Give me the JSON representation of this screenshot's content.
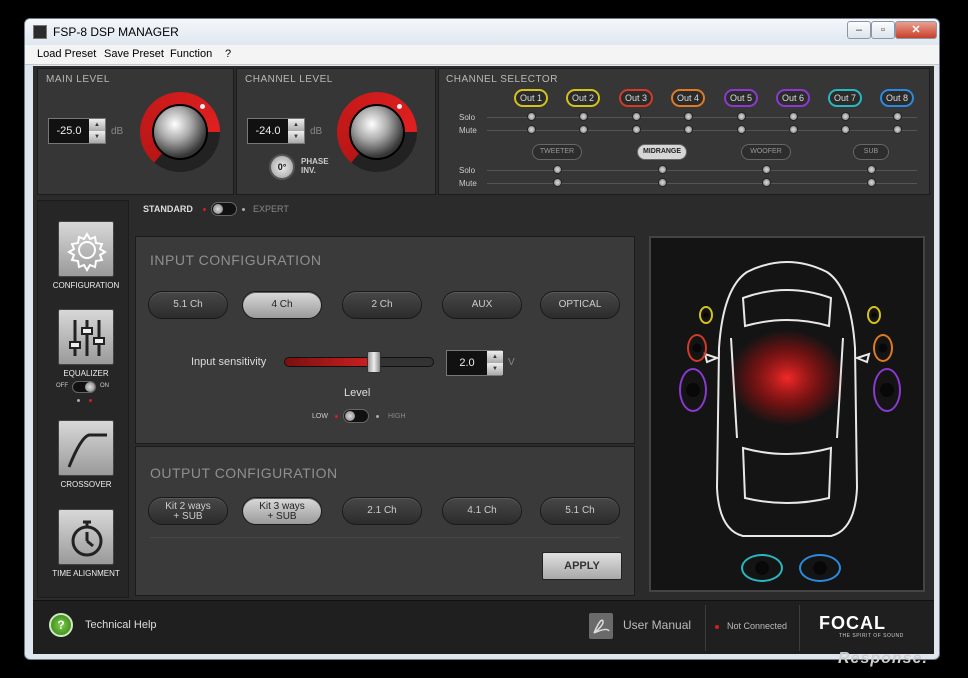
{
  "window": {
    "title": "FSP-8 DSP MANAGER",
    "min_glyph": "‒",
    "max_glyph": "▫",
    "close_glyph": "✕"
  },
  "menu": [
    "Load Preset",
    "Save Preset",
    "Function",
    "?"
  ],
  "main_level": {
    "label": "MAIN LEVEL",
    "value": "-25.0",
    "unit": "dB"
  },
  "channel_level": {
    "label": "CHANNEL LEVEL",
    "value": "-24.0",
    "unit": "dB",
    "phase_symbol": "0°",
    "phase_label_1": "PHASE",
    "phase_label_2": "INV."
  },
  "channel_selector": {
    "label": "CHANNEL SELECTOR",
    "outputs": [
      {
        "label": "Out 1",
        "color": "#d4c21a"
      },
      {
        "label": "Out 2",
        "color": "#d4c21a"
      },
      {
        "label": "Out 3",
        "color": "#d23a2a"
      },
      {
        "label": "Out 4",
        "color": "#e07a20"
      },
      {
        "label": "Out 5",
        "color": "#8a3ad0"
      },
      {
        "label": "Out 6",
        "color": "#8a3ad0"
      },
      {
        "label": "Out 7",
        "color": "#28b8c0"
      },
      {
        "label": "Out 8",
        "color": "#2a8ae0"
      }
    ],
    "solo_label": "Solo",
    "mute_label": "Mute",
    "groups": [
      "TWEETER",
      "MIDRANGE",
      "WOOFER",
      "SUB"
    ],
    "active_group": "MIDRANGE"
  },
  "mode": {
    "left": "STANDARD",
    "right": "EXPERT"
  },
  "sidebar": [
    {
      "label": "CONFIGURATION",
      "icon": "gear-icon"
    },
    {
      "label": "EQUALIZER",
      "icon": "sliders-icon"
    },
    {
      "label": "CROSSOVER",
      "icon": "crossover-curve-icon"
    },
    {
      "label": "TIME ALIGNMENT",
      "icon": "stopwatch-icon"
    }
  ],
  "eq_toggle": {
    "off": "OFF",
    "on": "ON"
  },
  "input_config": {
    "title": "INPUT CONFIGURATION",
    "buttons": [
      "5.1 Ch",
      "4 Ch",
      "2 Ch",
      "AUX",
      "OPTICAL"
    ],
    "selected": "4 Ch",
    "sensitivity_label": "Input sensitivity",
    "sensitivity_value": "2.0",
    "sensitivity_unit": "V",
    "sensitivity_fraction": 0.6,
    "level_label": "Level",
    "level_low": "LOW",
    "level_high": "HIGH"
  },
  "output_config": {
    "title": "OUTPUT CONFIGURATION",
    "buttons": [
      {
        "line1": "Kit 2 ways",
        "line2": "+ SUB"
      },
      {
        "line1": "Kit 3 ways",
        "line2": "+ SUB"
      },
      {
        "line1": "2.1 Ch",
        "line2": ""
      },
      {
        "line1": "4.1 Ch",
        "line2": ""
      },
      {
        "line1": "5.1 Ch",
        "line2": ""
      }
    ],
    "selected_index": 1,
    "apply_label": "APPLY"
  },
  "footer": {
    "help_symbol": "?",
    "help_label": "Technical Help",
    "manual_label": "User Manual",
    "status": "Not Connected",
    "brand": "FOCAL",
    "tagline": "THE SPIRIT OF SOUND"
  },
  "watermark": "Response."
}
